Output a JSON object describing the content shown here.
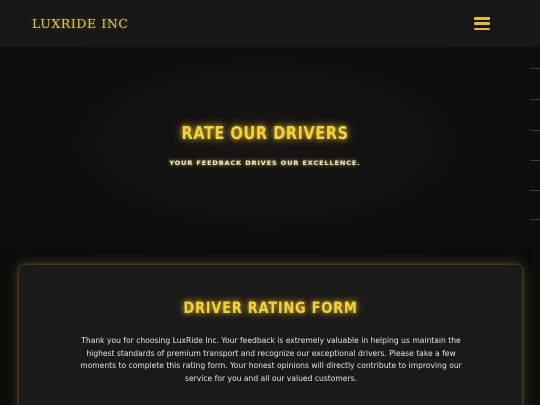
{
  "nav": {
    "brand": "LUXRIDE INC",
    "menu_icon": "hamburger-menu-icon"
  },
  "hero": {
    "title": "RATE OUR DRIVERS",
    "subtitle": "YOUR FEEDBACK DRIVES OUR EXCELLENCE."
  },
  "form": {
    "title": "DRIVER RATING FORM",
    "intro": "Thank you for choosing LuxRide Inc. Your feedback is extremely valuable in helping us maintain the highest standards of premium transport and recognize our exceptional drivers. Please take a few moments to complete this rating form. Your honest opinions will directly contribute to improving our service for you and all our valued customers."
  },
  "colors": {
    "accent": "#f6d13a",
    "brand": "#e6c75a",
    "background": "#0b0b0b",
    "navbar": "#171717",
    "card": "#1a1a1a"
  }
}
